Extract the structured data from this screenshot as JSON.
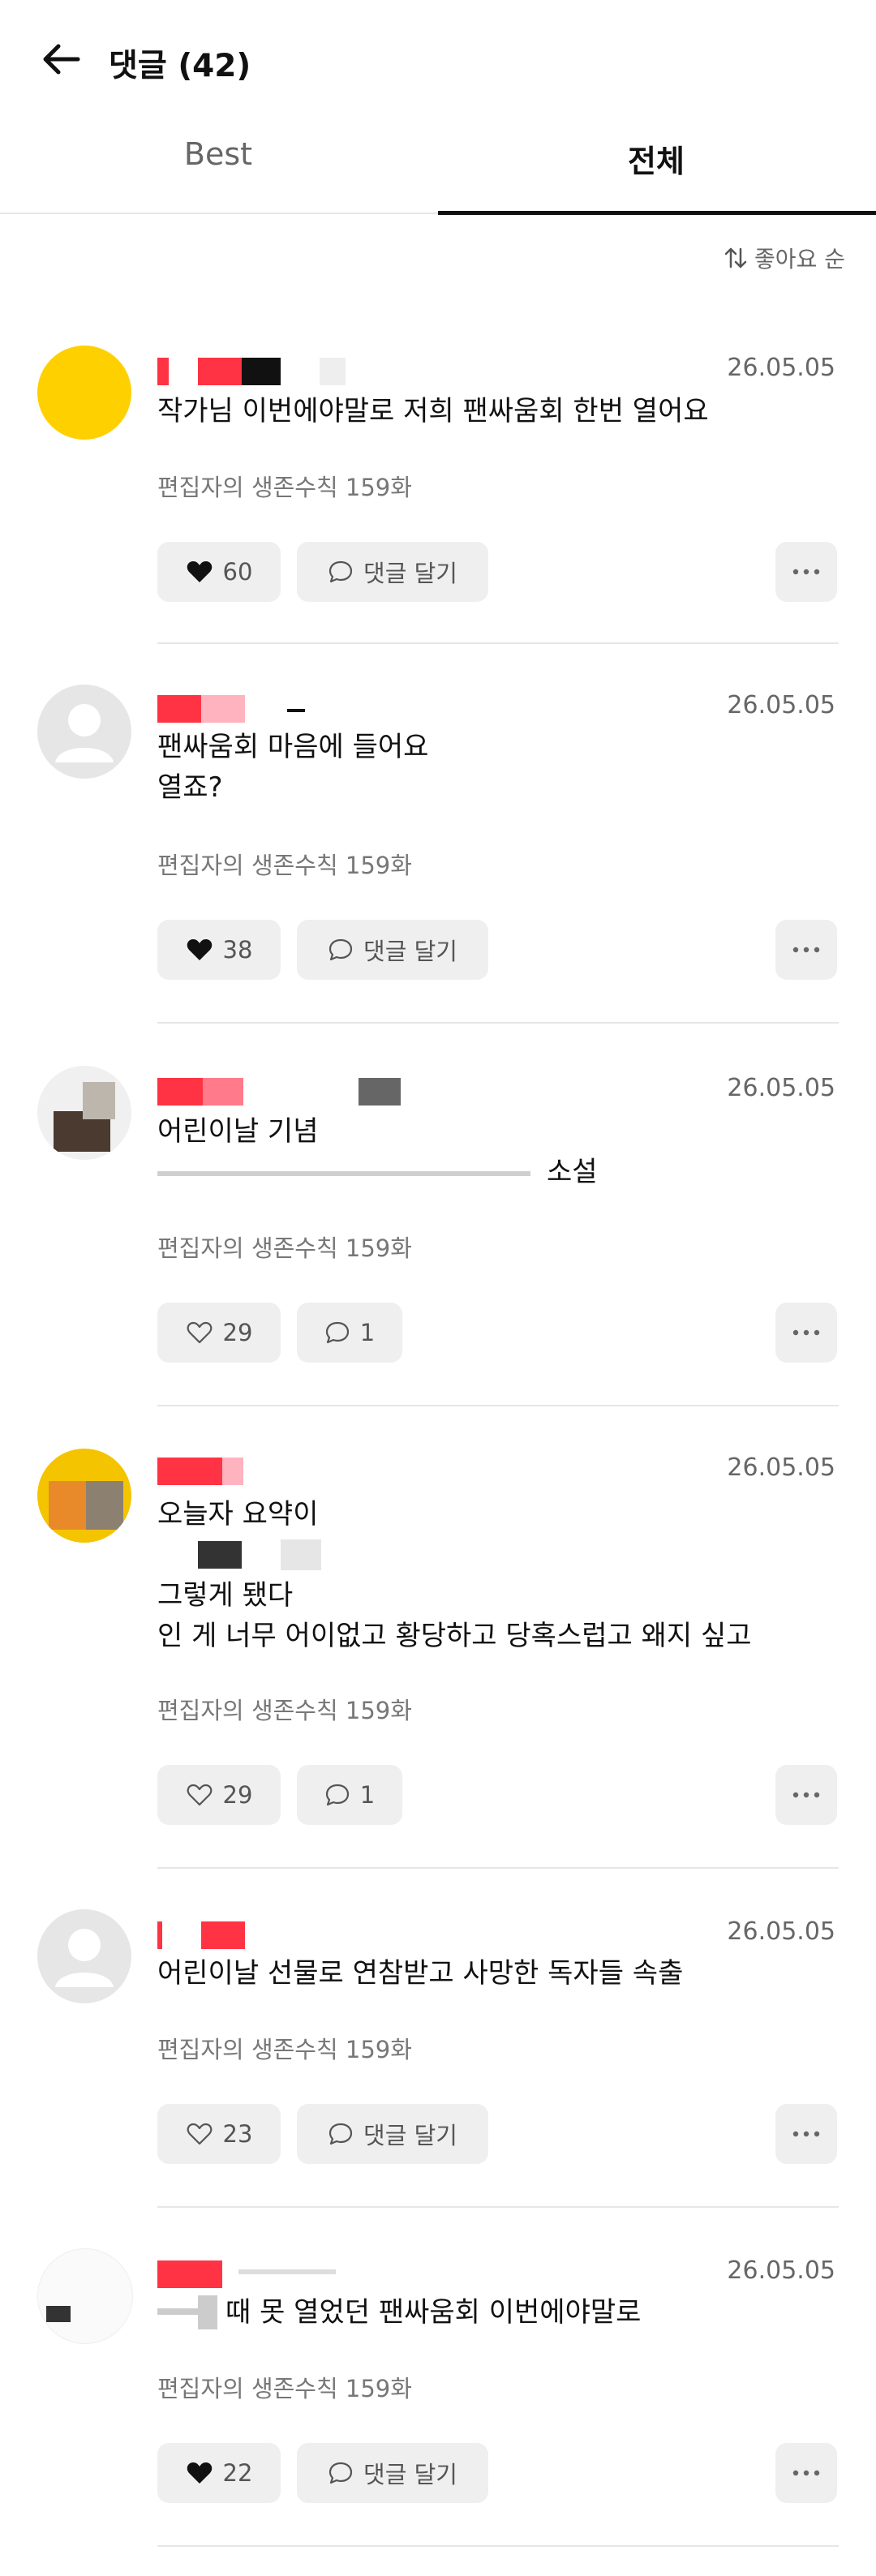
{
  "header": {
    "title": "댓글 (42)"
  },
  "tabs": [
    {
      "label": "Best"
    },
    {
      "label": "전체"
    }
  ],
  "sort": {
    "label": "좋아요 순"
  },
  "comments": [
    {
      "date": "26.05.05",
      "lines": [
        "작가님 이번에야말로 저희 팬싸움회 한번 열어요"
      ],
      "meta": "편집자의 생존수칙 159화",
      "likes": "60",
      "liked": true,
      "reply": "댓글 달기",
      "avatar": "yellow"
    },
    {
      "date": "26.05.05",
      "lines": [
        "팬싸움회 마음에 들어요",
        "열죠?"
      ],
      "meta": "편집자의 생존수칙 159화",
      "likes": "38",
      "liked": true,
      "reply": "댓글 달기",
      "avatar": "default"
    },
    {
      "date": "26.05.05",
      "lines": [
        "어린이날 기념",
        "소설"
      ],
      "meta": "편집자의 생존수칙 159화",
      "likes": "29",
      "liked": false,
      "reply": "1",
      "avatar": "photo"
    },
    {
      "date": "26.05.05",
      "lines": [
        "오늘자 요약이",
        "",
        "그렇게 됐다",
        "인 게 너무 어이없고 황당하고 당혹스럽고 왜지 싶고"
      ],
      "meta": "편집자의 생존수칙 159화",
      "likes": "29",
      "liked": false,
      "reply": "1",
      "avatar": "photo"
    },
    {
      "date": "26.05.05",
      "lines": [
        "어린이날 선물로 연참받고 사망한 독자들 속출"
      ],
      "meta": "편집자의 생존수칙 159화",
      "likes": "23",
      "liked": false,
      "reply": "댓글 달기",
      "avatar": "default"
    },
    {
      "date": "26.05.05",
      "lines": [
        "때 못 열었던 팬싸움회 이번에야말로"
      ],
      "meta": "편집자의 생존수칙 159화",
      "likes": "22",
      "liked": true,
      "reply": "댓글 달기",
      "avatar": "photo"
    }
  ],
  "icons": {
    "back": "arrow-left-icon",
    "sort": "sort-arrows-icon",
    "like": "heart-icon",
    "reply": "speech-bubble-icon",
    "more": "more-dots-icon"
  },
  "colors": {
    "accent": "#111111",
    "avatar_yellow": "#FFD000",
    "redacted": "#FF3344"
  }
}
